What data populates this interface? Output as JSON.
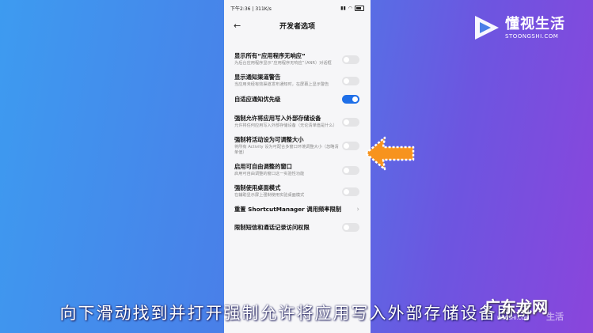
{
  "status_bar": {
    "time": "下午2:36",
    "speed": "311K/s",
    "battery_level": 0.7
  },
  "header": {
    "title": "开发者选项"
  },
  "settings": [
    {
      "title": "显示所有“应用程序无响应”",
      "desc": "为后台应用程序显示“应用程序无响应”（ANR）对话框",
      "control": "toggle",
      "on": false
    },
    {
      "title": "显示通知渠道警告",
      "desc": "当应用未经有效渠道发布通知时，在屏幕上显示警告",
      "control": "toggle",
      "on": false
    },
    {
      "title": "自适应通知优先级",
      "desc": "",
      "control": "toggle",
      "on": true
    },
    {
      "title": "强制允许将应用写入外部存储设备",
      "desc": "允许将任何应用写入外部存储设备（无论清单值是什么）",
      "control": "toggle",
      "on": false
    },
    {
      "title": "强制将活动设为可调整大小",
      "desc": "将所有 Activity 设为可配合多窗口环境调整大小（忽略清单值）",
      "control": "toggle",
      "on": false
    },
    {
      "title": "启用可自由调整的窗口",
      "desc": "启用可自由调整的窗口这一实验性功能",
      "control": "toggle",
      "on": false
    },
    {
      "title": "强制使用桌面模式",
      "desc": "在辅助显示屏上强制使用实验桌面模式",
      "control": "toggle",
      "on": false
    },
    {
      "title": "重置 ShortcutManager 调用频率限制",
      "desc": "",
      "control": "chevron",
      "on": false
    },
    {
      "title": "限制短信和通话记录访问权限",
      "desc": "",
      "control": "toggle",
      "on": false
    }
  ],
  "logo": {
    "name": "懂视生活",
    "domain": "STOONGSHI.COM"
  },
  "caption": "向下滑动找到并打开强制允许将应用写入外部存储设备即可",
  "watermark": {
    "text": "广东龙网",
    "sub": "LINGSHI.COM",
    "faded": "生活"
  },
  "colors": {
    "toggle_on": "#1f6fe8",
    "arrow": "#f7931e"
  }
}
